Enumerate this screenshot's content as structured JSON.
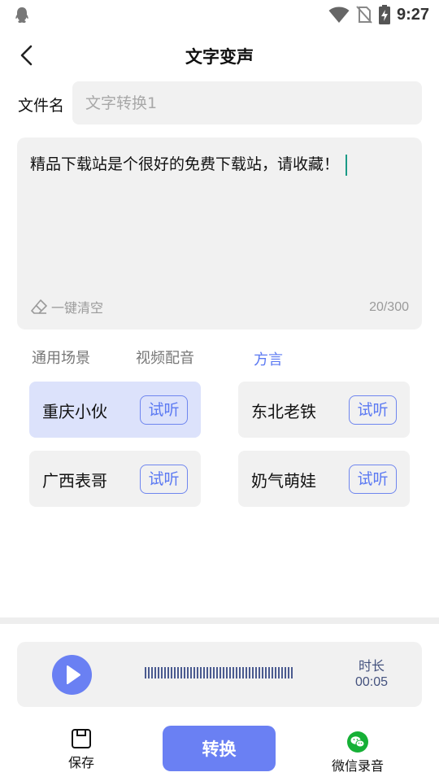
{
  "status_bar": {
    "time": "9:27",
    "icons": [
      "qq-icon",
      "wifi-icon",
      "no-sim-icon",
      "battery-charging-icon"
    ]
  },
  "header": {
    "title": "文字变声",
    "back_icon": "chevron-left-icon"
  },
  "filename": {
    "label": "文件名",
    "value": "",
    "placeholder": "文字转换1"
  },
  "editor": {
    "text": "精品下载站是个很好的免费下载站，请收藏！",
    "clear_label": "一键清空",
    "clear_icon": "eraser-icon",
    "counter": "20/300",
    "caret_color": "#1a9a86"
  },
  "tabs": [
    {
      "label": "通用场景",
      "active": false
    },
    {
      "label": "视频配音",
      "active": false
    },
    {
      "label": "方言",
      "active": true
    }
  ],
  "voices": [
    {
      "name": "重庆小伙",
      "try_label": "试听",
      "selected": true
    },
    {
      "name": "东北老铁",
      "try_label": "试听",
      "selected": false
    },
    {
      "name": "广西表哥",
      "try_label": "试听",
      "selected": false
    },
    {
      "name": "奶气萌娃",
      "try_label": "试听",
      "selected": false
    }
  ],
  "player": {
    "play_icon": "play-icon",
    "duration_label": "时长",
    "duration_value": "00:05"
  },
  "bottom_bar": {
    "save_label": "保存",
    "save_icon": "save-icon",
    "convert_label": "转换",
    "wechat_label": "微信录音",
    "wechat_icon": "wechat-icon"
  },
  "colors": {
    "accent": "#6a80f3",
    "accent_text": "#5b79f2",
    "selected_bg": "#dce2fb",
    "panel_bg": "#f1f1f1",
    "wechat_green": "#16b036"
  }
}
